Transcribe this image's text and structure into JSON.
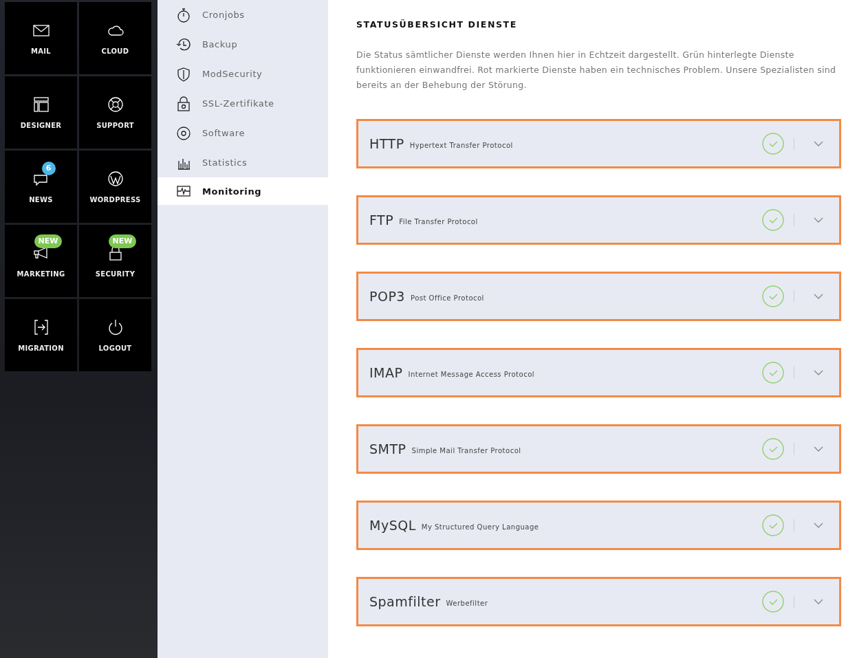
{
  "tiles": [
    {
      "label": "MAIL"
    },
    {
      "label": "CLOUD"
    },
    {
      "label": "DESIGNER"
    },
    {
      "label": "SUPPORT"
    },
    {
      "label": "NEWS",
      "badge": {
        "text": "6",
        "kind": "count"
      }
    },
    {
      "label": "WORDPRESS"
    },
    {
      "label": "MARKETING",
      "badge": {
        "text": "NEW",
        "kind": "new"
      }
    },
    {
      "label": "SECURITY",
      "badge": {
        "text": "NEW",
        "kind": "new"
      }
    },
    {
      "label": "MIGRATION"
    },
    {
      "label": "LOGOUT"
    }
  ],
  "nav": [
    {
      "label": "Cronjobs",
      "selected": false
    },
    {
      "label": "Backup",
      "selected": false
    },
    {
      "label": "ModSecurity",
      "selected": false
    },
    {
      "label": "SSL-Zertifikate",
      "selected": false
    },
    {
      "label": "Software",
      "selected": false
    },
    {
      "label": "Statistics",
      "selected": false
    },
    {
      "label": "Monitoring",
      "selected": true
    }
  ],
  "heading": "STATUSÜBERSICHT DIENSTE",
  "intro": "Die Status sämtlicher Dienste werden Ihnen hier in Echtzeit dargestellt. Grün hinterlegte Dienste funktionieren einwandfrei. Rot markierte Dienste haben ein technisches Problem. Unsere Spezialisten sind bereits an der Behebung der Störung.",
  "services": [
    {
      "name": "HTTP",
      "description": "Hypertext Transfer Protocol",
      "ok": true
    },
    {
      "name": "FTP",
      "description": "File Transfer Protocol",
      "ok": true
    },
    {
      "name": "POP3",
      "description": "Post Office Protocol",
      "ok": true
    },
    {
      "name": "IMAP",
      "description": "Internet Message Access Protocol",
      "ok": true
    },
    {
      "name": "SMTP",
      "description": "Simple Mail Transfer Protocol",
      "ok": true
    },
    {
      "name": "MySQL",
      "description": "My Structured Query Language",
      "ok": true
    },
    {
      "name": "Spamfilter",
      "description": "Werbefilter",
      "ok": true
    }
  ]
}
